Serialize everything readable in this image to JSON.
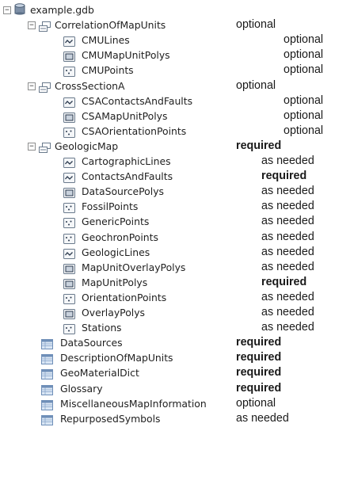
{
  "tree": {
    "root": {
      "label": "example.gdb",
      "icon": "geodatabase-icon",
      "toggle": "−"
    },
    "datasets": [
      {
        "label": "CorrelationOfMapUnits",
        "icon": "feature-dataset-icon",
        "toggle": "−",
        "requirement": "optional",
        "bold": false,
        "children": [
          {
            "label": "CMULines",
            "icon": "line-feature-class-icon",
            "requirement": "optional",
            "bold": false
          },
          {
            "label": "CMUMapUnitPolys",
            "icon": "polygon-feature-class-icon",
            "requirement": "optional",
            "bold": false
          },
          {
            "label": "CMUPoints",
            "icon": "point-feature-class-icon",
            "requirement": "optional",
            "bold": false
          }
        ]
      },
      {
        "label": "CrossSectionA",
        "icon": "feature-dataset-icon",
        "toggle": "−",
        "requirement": "optional",
        "bold": false,
        "children": [
          {
            "label": "CSAContactsAndFaults",
            "icon": "line-feature-class-icon",
            "requirement": "optional",
            "bold": false
          },
          {
            "label": "CSAMapUnitPolys",
            "icon": "polygon-feature-class-icon",
            "requirement": "optional",
            "bold": false
          },
          {
            "label": "CSAOrientationPoints",
            "icon": "point-feature-class-icon",
            "requirement": "optional",
            "bold": false
          }
        ]
      },
      {
        "label": "GeologicMap",
        "icon": "feature-dataset-icon",
        "toggle": "−",
        "requirement": "required",
        "bold": true,
        "children": [
          {
            "label": "CartographicLines",
            "icon": "line-feature-class-icon",
            "requirement": "as needed",
            "bold": false
          },
          {
            "label": "ContactsAndFaults",
            "icon": "line-feature-class-icon",
            "requirement": "required",
            "bold": true
          },
          {
            "label": "DataSourcePolys",
            "icon": "polygon-feature-class-icon",
            "requirement": "as needed",
            "bold": false
          },
          {
            "label": "FossilPoints",
            "icon": "point-feature-class-icon",
            "requirement": "as needed",
            "bold": false
          },
          {
            "label": "GenericPoints",
            "icon": "point-feature-class-icon",
            "requirement": "as needed",
            "bold": false
          },
          {
            "label": "GeochronPoints",
            "icon": "point-feature-class-icon",
            "requirement": "as needed",
            "bold": false
          },
          {
            "label": "GeologicLines",
            "icon": "line-feature-class-icon",
            "requirement": "as needed",
            "bold": false
          },
          {
            "label": "MapUnitOverlayPolys",
            "icon": "polygon-feature-class-icon",
            "requirement": "as needed",
            "bold": false
          },
          {
            "label": "MapUnitPolys",
            "icon": "polygon-feature-class-icon",
            "requirement": "required",
            "bold": true
          },
          {
            "label": "OrientationPoints",
            "icon": "point-feature-class-icon",
            "requirement": "as needed",
            "bold": false
          },
          {
            "label": "OverlayPolys",
            "icon": "polygon-feature-class-icon",
            "requirement": "as needed",
            "bold": false
          },
          {
            "label": "Stations",
            "icon": "point-feature-class-icon",
            "requirement": "as needed",
            "bold": false
          }
        ]
      }
    ],
    "tables": [
      {
        "label": "DataSources",
        "icon": "table-icon",
        "requirement": "required",
        "bold": true
      },
      {
        "label": "DescriptionOfMapUnits",
        "icon": "table-icon",
        "requirement": "required",
        "bold": true
      },
      {
        "label": "GeoMaterialDict",
        "icon": "table-icon",
        "requirement": "required",
        "bold": true
      },
      {
        "label": "Glossary",
        "icon": "table-icon",
        "requirement": "required",
        "bold": true
      },
      {
        "label": "MiscellaneousMapInformation",
        "icon": "table-icon",
        "requirement": "optional",
        "bold": false
      },
      {
        "label": "RepurposedSymbols",
        "icon": "table-icon",
        "requirement": "as needed",
        "bold": false
      }
    ]
  },
  "colors": {
    "text": "#1f1f1f",
    "icon_border": "#6a7a8c",
    "icon_fill": "#f4f6f8",
    "table_fill": "#dbe7f5",
    "toggle_border": "#8e8f8f"
  }
}
